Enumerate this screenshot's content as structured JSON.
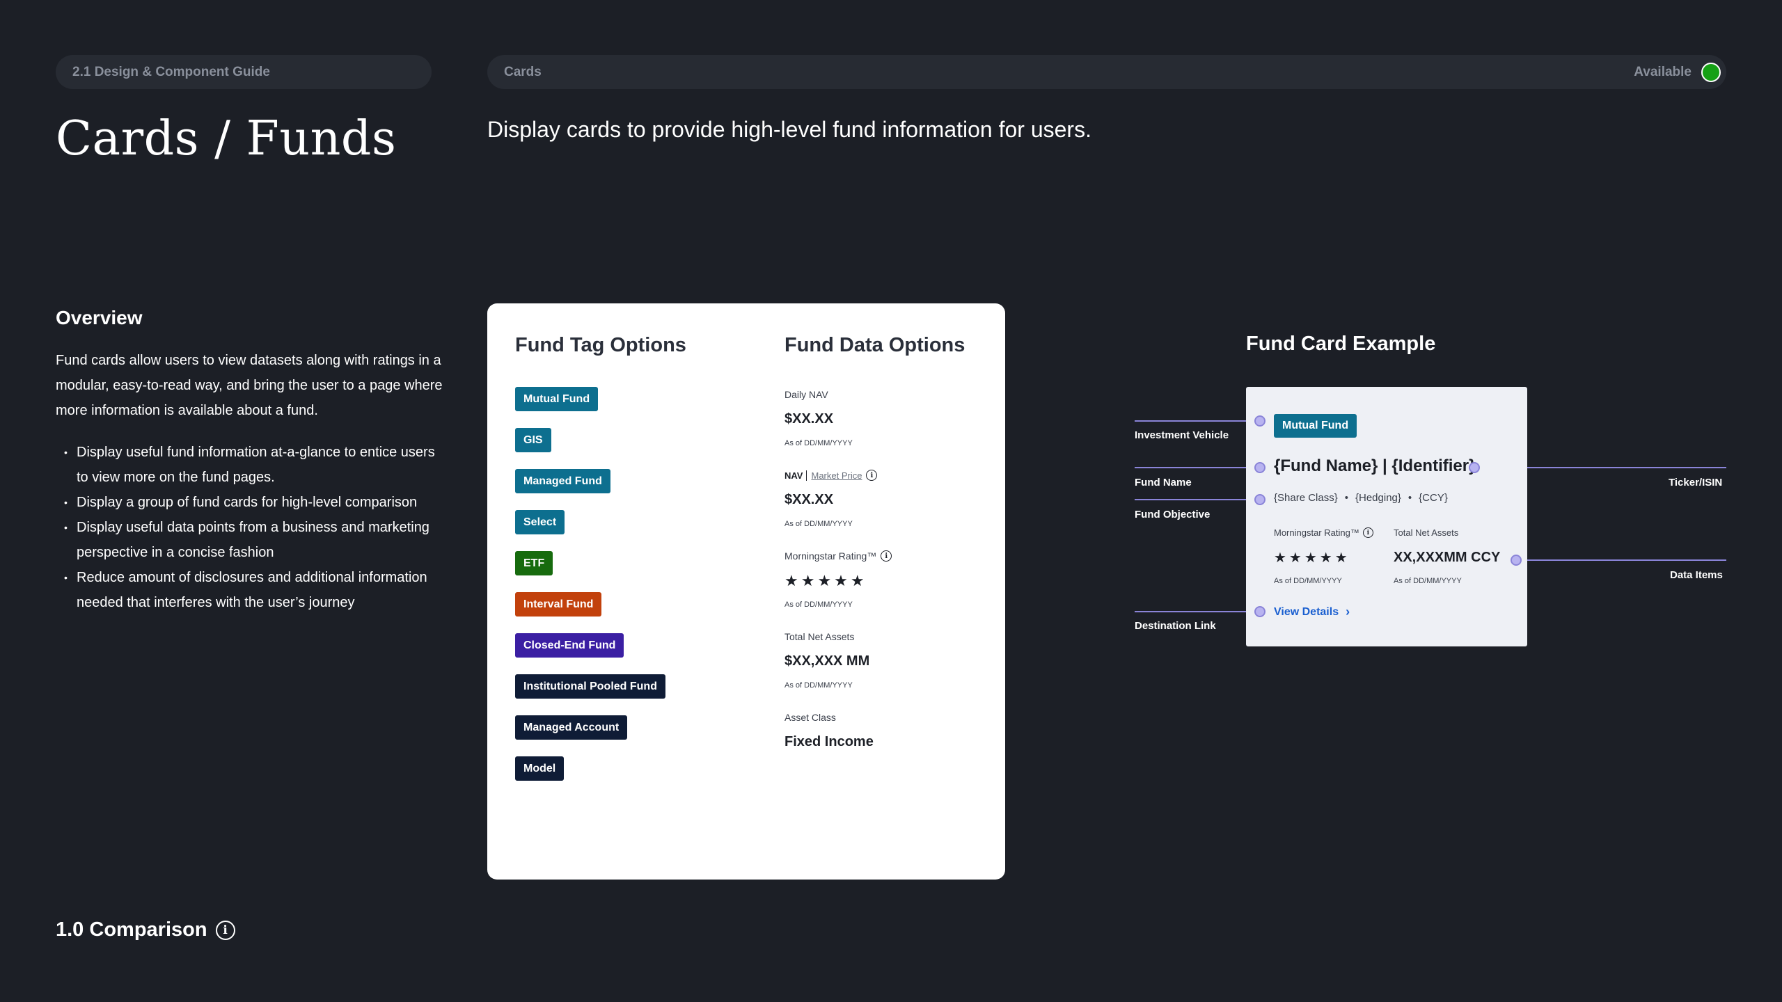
{
  "header": {
    "guide_label": "2.1 Design & Component Guide",
    "section_label": "Cards",
    "status_label": "Available",
    "status_color": "#15a015"
  },
  "title": "Cards / Funds",
  "description": "Display cards to provide high-level fund information for users.",
  "overview": {
    "heading": "Overview",
    "body": "Fund cards allow users to view datasets along with ratings in a modular, easy-to-read way, and bring the user to a page where more information is available about a fund.",
    "bullets": [
      "Display useful fund information at-a-glance to entice users to view more on the fund pages.",
      "Display a group of fund cards for high-level comparison",
      "Display useful data points from a business and marketing perspective in a concise fashion",
      "Reduce amount of disclosures and additional information needed that interferes with the user’s journey"
    ]
  },
  "comparison": {
    "heading": "1.0 Comparison",
    "icon": "info-icon"
  },
  "fund_tags": {
    "heading": "Fund Tag Options",
    "tags": [
      {
        "label": "Mutual Fund",
        "color": "#0d6f8f"
      },
      {
        "label": "GIS",
        "color": "#0d6f8f"
      },
      {
        "label": "Managed Fund",
        "color": "#0d6f8f"
      },
      {
        "label": "Select",
        "color": "#0d6f8f"
      },
      {
        "label": "ETF",
        "color": "#176b0e"
      },
      {
        "label": "Interval Fund",
        "color": "#c2410c"
      },
      {
        "label": "Closed-End Fund",
        "color": "#3b1fa3"
      },
      {
        "label": "Institutional Pooled Fund",
        "color": "#0f1c36"
      },
      {
        "label": "Managed Account",
        "color": "#0f1c36"
      },
      {
        "label": "Model",
        "color": "#0f1c36"
      }
    ]
  },
  "fund_data": {
    "heading": "Fund Data Options",
    "daily_nav": {
      "label": "Daily NAV",
      "value": "$XX.XX",
      "asof": "As of DD/MM/YYYY"
    },
    "nav": {
      "label_active": "NAV",
      "label_alt": "Market Price",
      "value": "$XX.XX",
      "asof": "As of DD/MM/YYYY"
    },
    "rating": {
      "label": "Morningstar Rating™",
      "stars": "★★★★★",
      "asof": "As of DD/MM/YYYY"
    },
    "tna": {
      "label": "Total Net Assets",
      "value": "$XX,XXX MM",
      "asof": "As of DD/MM/YYYY"
    },
    "asset_class": {
      "label": "Asset Class",
      "value": "Fixed Income"
    }
  },
  "example": {
    "heading": "Fund Card Example",
    "tag": "Mutual Fund",
    "fund_name": "{Fund Name} | {Identifier}",
    "share_class": "{Share Class}",
    "hedging": "{Hedging}",
    "ccy": "{CCY}",
    "rating_label": "Morningstar Rating™",
    "stars": "★★★★★",
    "rating_asof": "As of DD/MM/YYYY",
    "tna_label": "Total Net Assets",
    "tna_value": "XX,XXXMM CCY",
    "tna_asof": "As of DD/MM/YYYY",
    "link": "View Details",
    "annotations": {
      "investment_vehicle": "Investment Vehicle",
      "fund_name": "Fund Name",
      "fund_objective": "Fund Objective",
      "destination_link": "Destination Link",
      "ticker": "Ticker/ISIN",
      "data_items": "Data Items"
    }
  }
}
